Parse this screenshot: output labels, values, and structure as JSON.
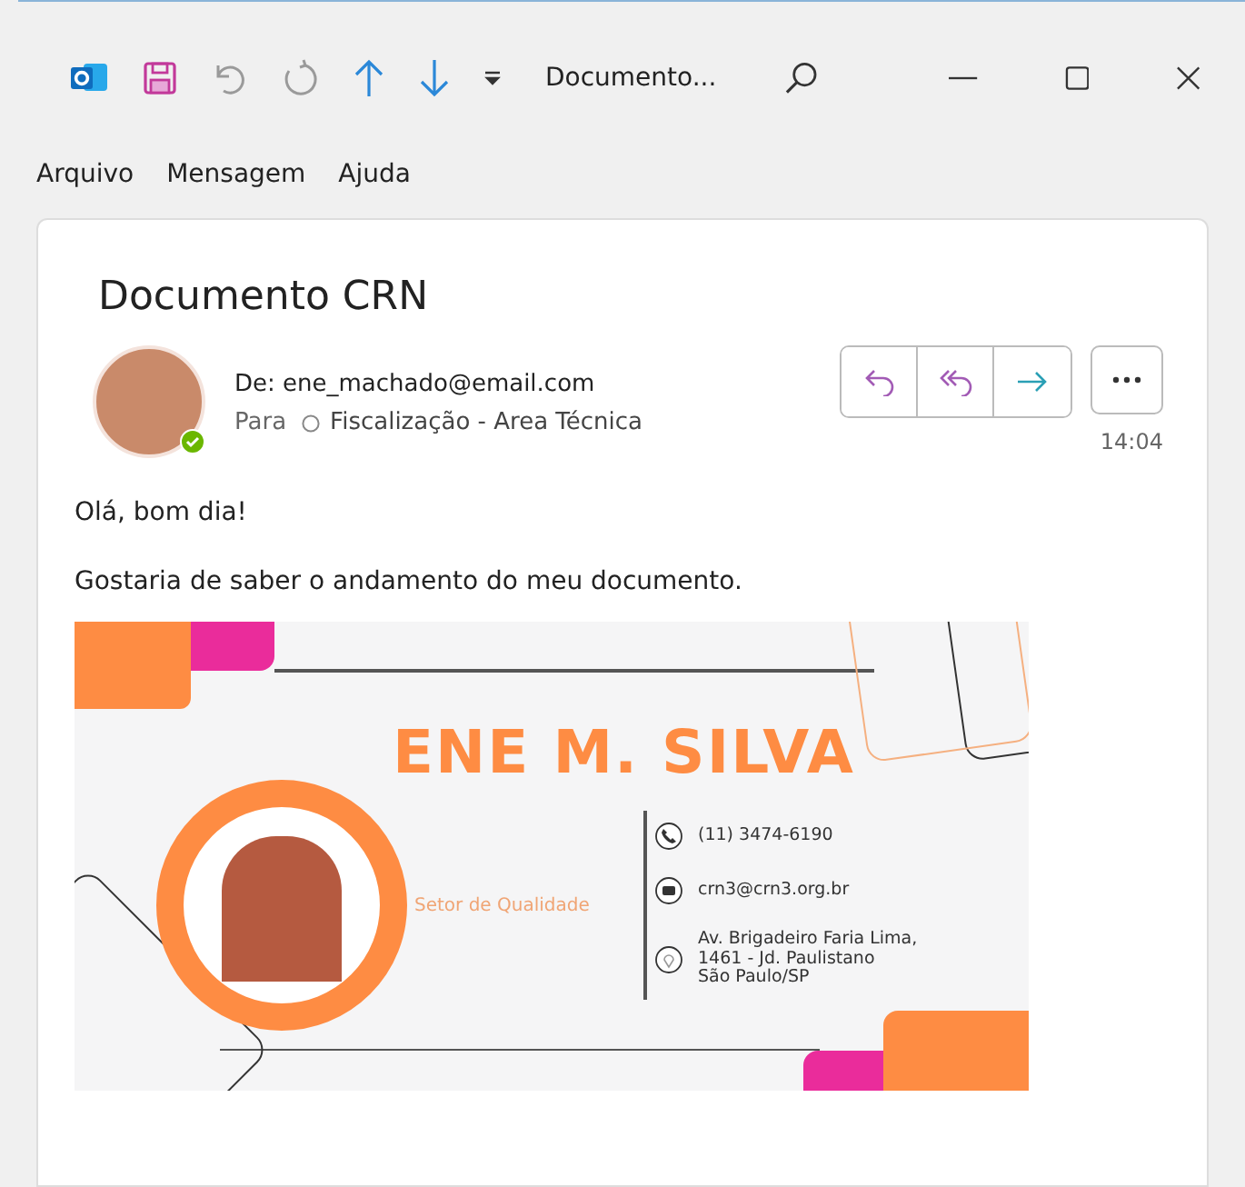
{
  "window": {
    "title": "Documento..."
  },
  "quick_access": [
    {
      "kind": "save",
      "disabled": false
    },
    {
      "kind": "undo",
      "disabled": true
    },
    {
      "kind": "redo",
      "disabled": true
    },
    {
      "kind": "up",
      "disabled": false
    },
    {
      "kind": "down",
      "disabled": false
    }
  ],
  "menu": [
    "Arquivo",
    "Mensagem",
    "Ajuda"
  ],
  "message": {
    "subject": "Documento CRN",
    "from": "De: ene_machado@email.com",
    "to_label": "Para",
    "to": "Fiscalização - Area Técnica",
    "time": "14:04",
    "actions": [
      {
        "kind": "reply"
      },
      {
        "kind": "reply_all"
      },
      {
        "kind": "forward"
      }
    ],
    "body": [
      "Olá, bom dia!",
      "Gostaria de saber o andamento do meu documento."
    ]
  },
  "card": {
    "name": "ENE M. SILVA",
    "department": "Setor de Qualidade",
    "contacts": [
      {
        "kind": "phone",
        "lines": [
          "(11) 3474-6190"
        ]
      },
      {
        "kind": "email",
        "lines": [
          "crn3@crn3.org.br"
        ]
      },
      {
        "kind": "address",
        "lines": [
          "Av. Brigadeiro Faria Lima,",
          "1461 - Jd. Paulistano",
          "São Paulo/SP"
        ]
      }
    ]
  }
}
